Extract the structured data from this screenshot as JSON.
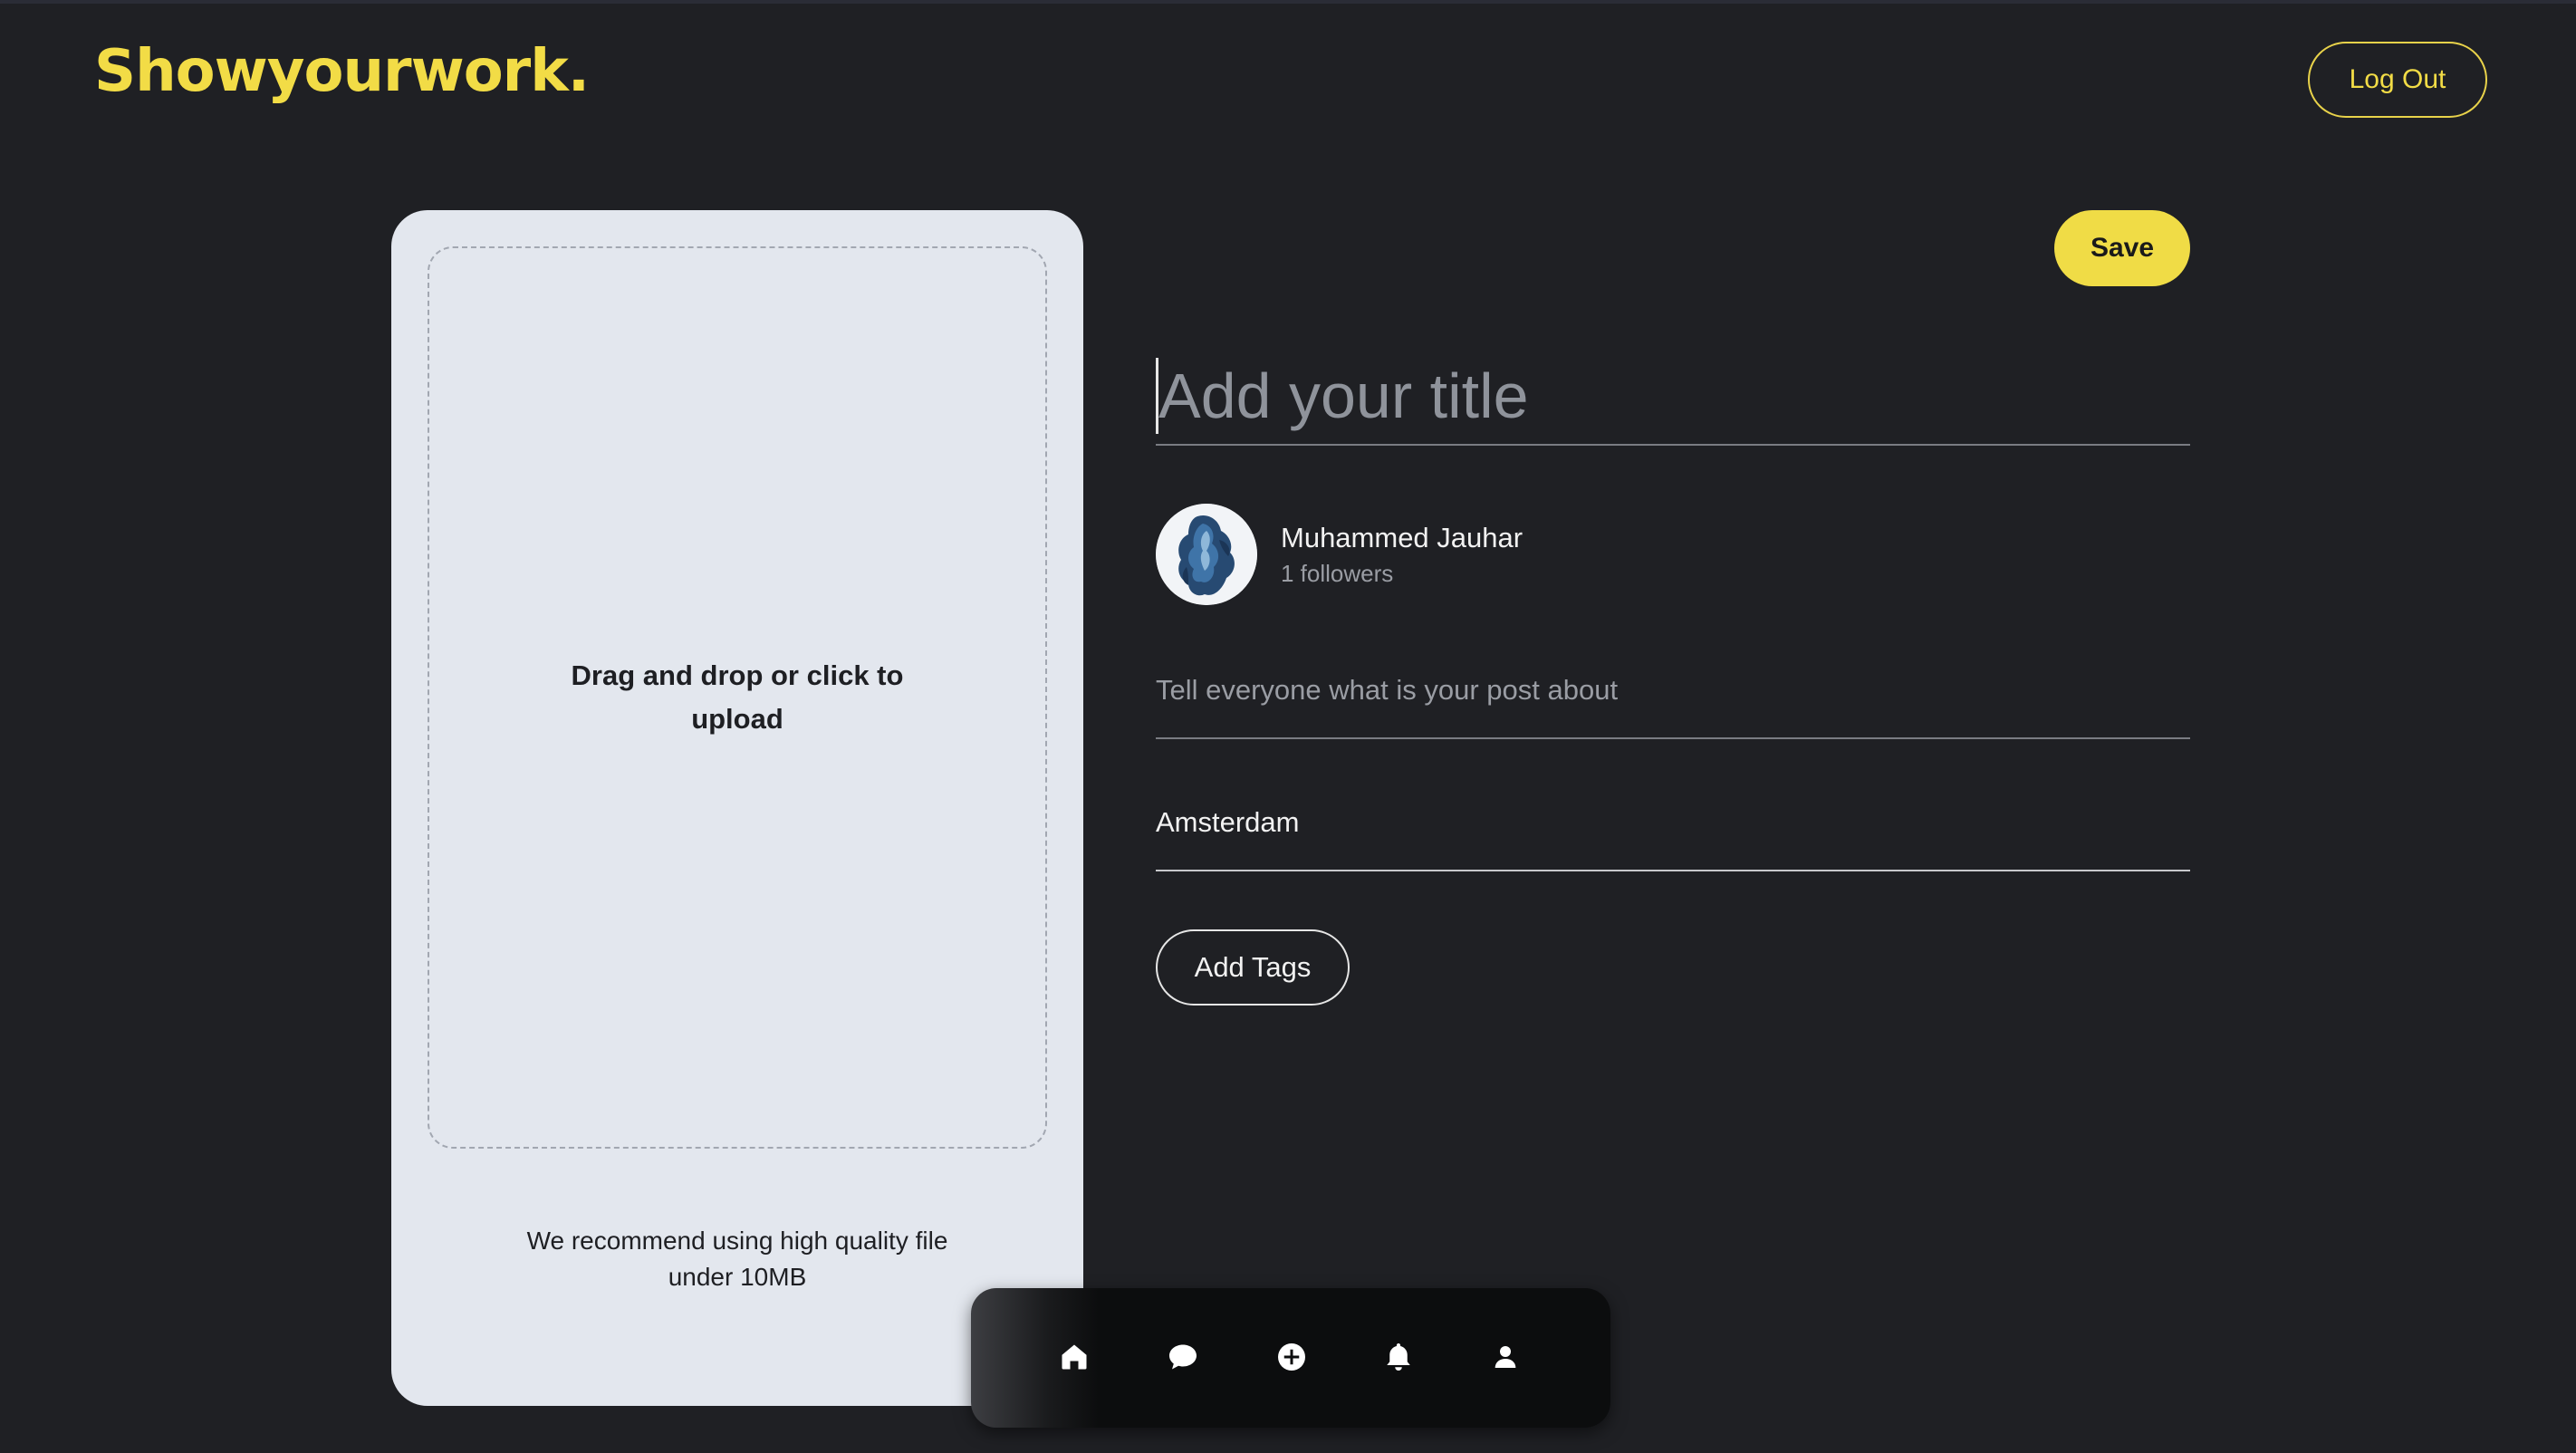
{
  "header": {
    "logo": "Showyourwork.",
    "logout_label": "Log Out"
  },
  "upload": {
    "dropzone_text": "Drag and drop or click to upload",
    "recommendation": "We recommend using high quality file under 10MB"
  },
  "editor": {
    "save_label": "Save",
    "title_placeholder": "Add your title",
    "description_placeholder": "Tell everyone what is your post about",
    "location_value": "Amsterdam",
    "add_tags_label": "Add Tags"
  },
  "author": {
    "name": "Muhammed Jauhar",
    "followers": "1 followers"
  },
  "bottom_nav": {
    "items": [
      "home-icon",
      "chat-icon",
      "add-circle-icon",
      "bell-icon",
      "user-icon"
    ],
    "active": "home-icon"
  },
  "colors": {
    "background": "#1f2024",
    "accent": "#f0dc46",
    "card": "#e3e7ee"
  }
}
